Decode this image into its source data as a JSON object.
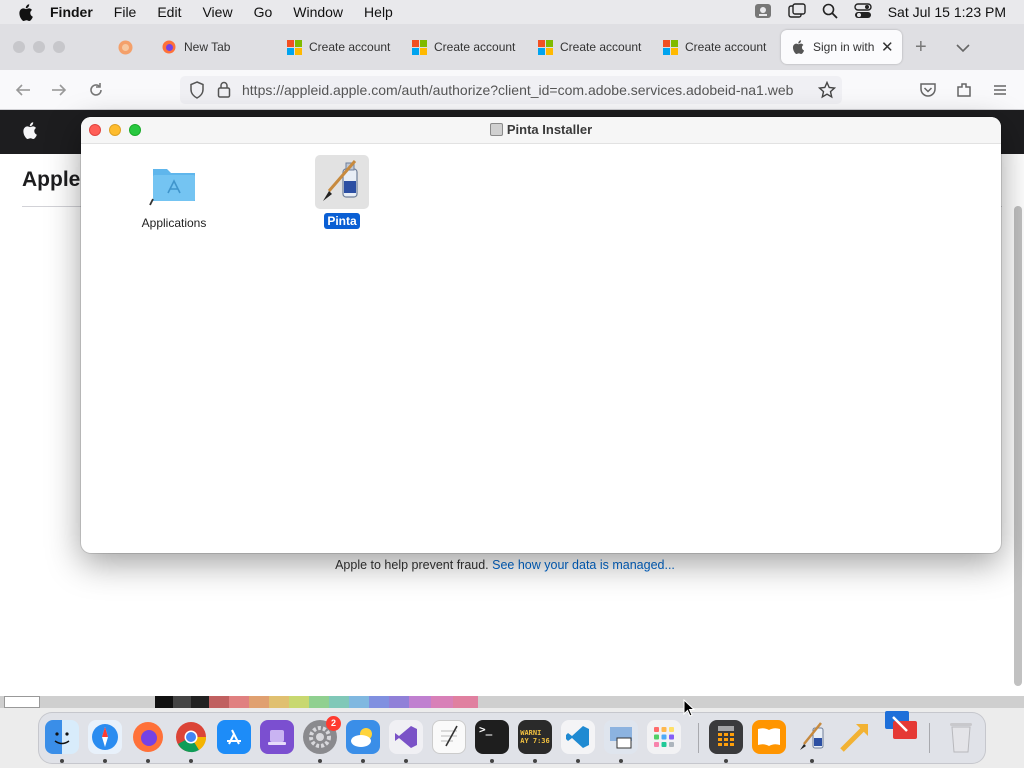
{
  "menubar": {
    "app_name": "Finder",
    "items": [
      "File",
      "Edit",
      "View",
      "Go",
      "Window",
      "Help"
    ],
    "clock": "Sat Jul 15  1:23 PM"
  },
  "browser": {
    "tabs": [
      {
        "label": "New Tab"
      },
      {
        "label": "Create account"
      },
      {
        "label": "Create account"
      },
      {
        "label": "Create account"
      },
      {
        "label": "Create account"
      },
      {
        "label": "Sign in with A"
      }
    ],
    "url": "https://appleid.apple.com/auth/authorize?client_id=com.adobe.services.adobeid-na1.web"
  },
  "page": {
    "title": "Apple",
    "fraud_text": "Apple to help prevent fraud.",
    "fraud_link": "See how your data is managed..."
  },
  "installer": {
    "title": "Pinta Installer",
    "items": [
      {
        "label": "Applications"
      },
      {
        "label": "Pinta"
      }
    ]
  },
  "dock": {
    "badge_count": "2",
    "terminal_glyph": ">_",
    "console_text": "WARNI\nAY 7:36"
  },
  "colors": {
    "accent": "#0a5fd4",
    "link": "#0066cc"
  }
}
